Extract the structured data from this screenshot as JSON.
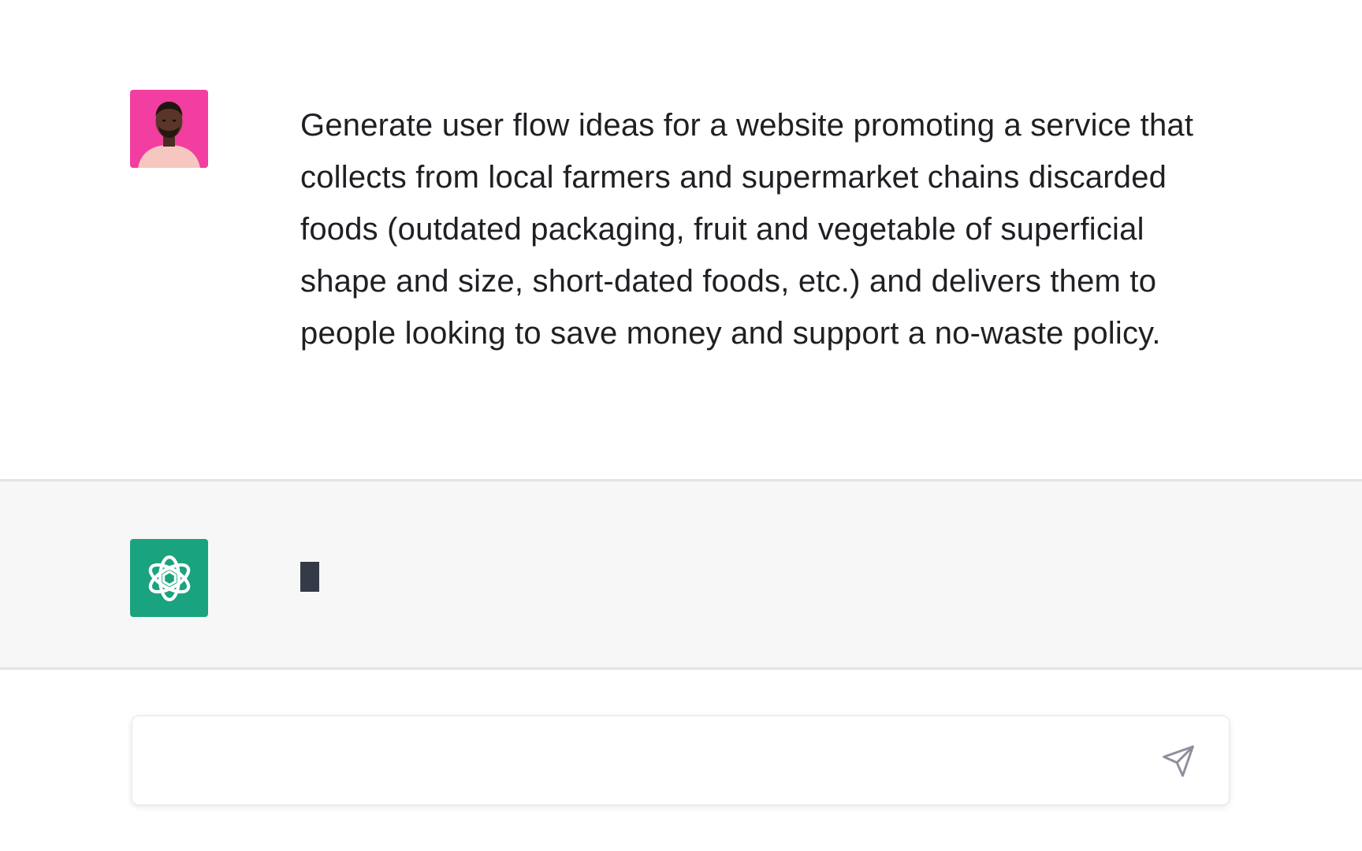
{
  "conversation": {
    "user_message": {
      "text": "Generate user flow ideas for a website promoting a service that collects from local farmers and supermarket chains discarded foods (outdated packaging, fruit and vegetable of superficial shape and size, short-dated foods, etc.) and delivers them to people looking to save money and support a no-waste policy.",
      "avatar_icon": "user-avatar-photo",
      "avatar_bg": "#f23ea0"
    },
    "assistant_message": {
      "text": "",
      "avatar_icon": "openai-logo-icon",
      "avatar_bg": "#19a37f",
      "state": "typing"
    }
  },
  "composer": {
    "placeholder": "",
    "value": "",
    "send_icon": "send-icon"
  },
  "colors": {
    "assistant_row_bg": "#f7f7f8",
    "cursor": "#343a46",
    "send_icon": "#8e8ea0"
  }
}
